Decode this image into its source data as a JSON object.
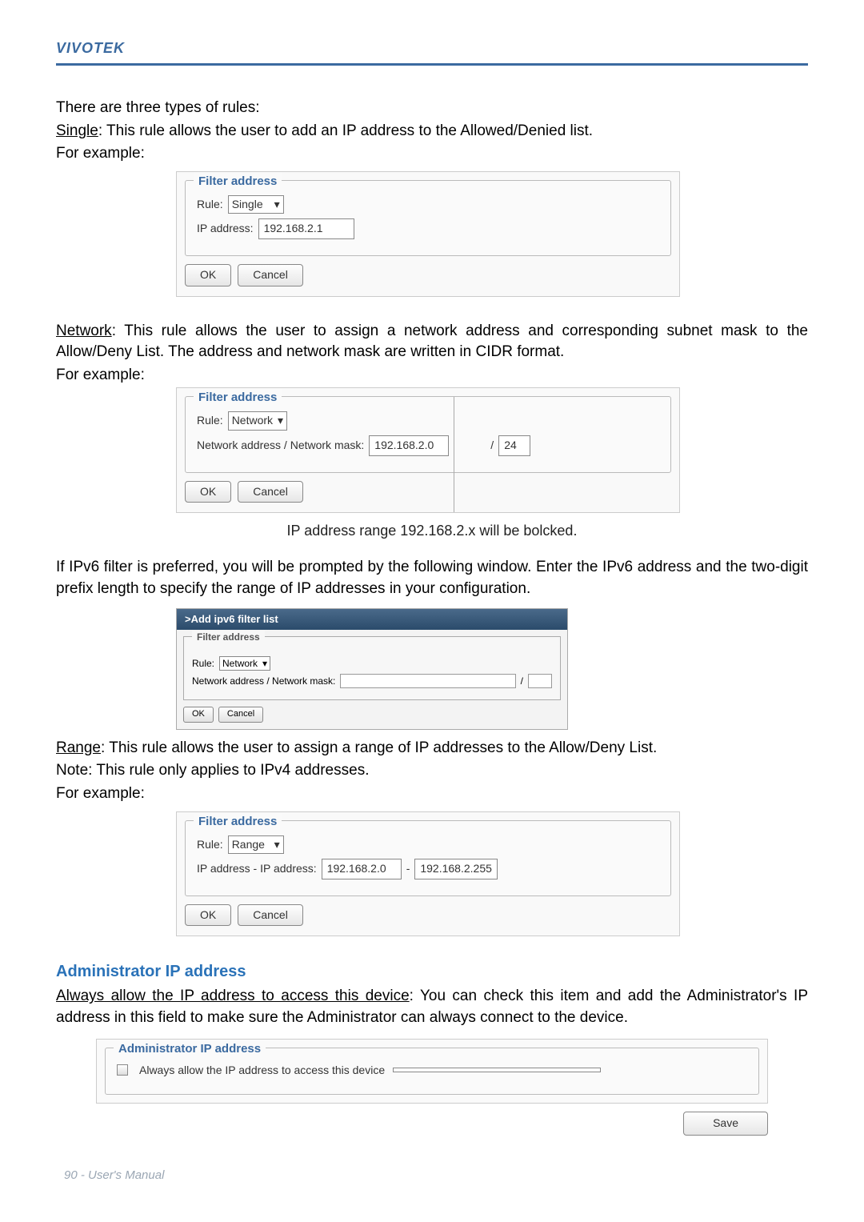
{
  "brand": "VIVOTEK",
  "intro": {
    "line1": "There are three types of rules:",
    "single_label": "Single",
    "single_desc": ": This rule allows the user to add an IP address to the Allowed/Denied list.",
    "for_example": "For example:"
  },
  "fig_single": {
    "legend": "Filter address",
    "rule_label": "Rule:",
    "rule_value": "Single",
    "ip_label": "IP address:",
    "ip_value": "192.168.2.1",
    "ok": "OK",
    "cancel": "Cancel"
  },
  "network": {
    "label": "Network",
    "desc": ": This rule allows the user to assign a network address and corresponding subnet mask to the Allow/Deny List. The address and network mask are written in CIDR format.",
    "for_example": "For example:"
  },
  "fig_network": {
    "legend": "Filter address",
    "rule_label": "Rule:",
    "rule_value": "Network",
    "net_label": "Network address / Network mask:",
    "net_value": "192.168.2.0",
    "mask_sep": "/",
    "mask_value": "24",
    "ok": "OK",
    "cancel": "Cancel",
    "caption": "IP address range 192.168.2.x will be bolcked."
  },
  "ipv6_intro": "If IPv6 filter is preferred, you will be prompted by the following window. Enter the IPv6 address and the two-digit prefix length to specify the range of IP addresses in your configuration.",
  "fig_ipv6": {
    "title": ">Add ipv6 filter list",
    "legend": "Filter address",
    "rule_label": "Rule:",
    "rule_value": "Network",
    "net_label": "Network address / Network mask:",
    "mask_sep": "/",
    "ok": "OK",
    "cancel": "Cancel"
  },
  "range": {
    "label": "Range",
    "desc": ": This rule allows the user to assign a range of IP addresses to the Allow/Deny List.",
    "note": "Note: This rule only applies to IPv4 addresses.",
    "for_example": "For example:"
  },
  "fig_range": {
    "legend": "Filter address",
    "rule_label": "Rule:",
    "rule_value": "Range",
    "ip_label": "IP address - IP address:",
    "ip_from": "192.168.2.0",
    "dash": "-",
    "ip_to": "192.168.2.255",
    "ok": "OK",
    "cancel": "Cancel"
  },
  "admin": {
    "heading": "Administrator IP address",
    "label": "Always allow the IP address to access this device",
    "desc": ": You can check this item and add the Administrator's IP address in this field to make sure the Administrator can always connect to the device.",
    "legend": "Administrator IP address",
    "checkbox_label": "Always allow the IP address to access this device",
    "save": "Save"
  },
  "footer": "90 - User's Manual"
}
